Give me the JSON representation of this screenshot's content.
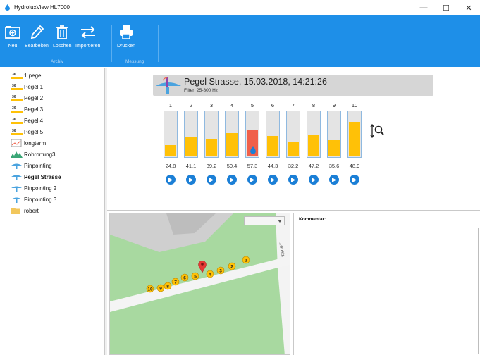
{
  "window": {
    "title": "HydroluxView HL7000",
    "minimize": "—",
    "maximize": "☐",
    "close": "✕"
  },
  "ribbon": {
    "buttons": [
      {
        "label": "Neu",
        "icon": "folder-new-icon"
      },
      {
        "label": "Bearbeiten",
        "icon": "pencil-icon"
      },
      {
        "label": "Löschen",
        "icon": "trash-icon"
      },
      {
        "label": "Importieren",
        "icon": "import-arrows-icon"
      },
      {
        "label": "Drucken",
        "icon": "printer-icon"
      }
    ],
    "groups": [
      "Archiv",
      "Messung"
    ]
  },
  "tree": {
    "items": [
      {
        "label": "1 pegel",
        "icon": "pegel-icon"
      },
      {
        "label": "Pegel 1",
        "icon": "pegel-icon"
      },
      {
        "label": "Pegel 2",
        "icon": "pegel-icon"
      },
      {
        "label": "Pegel 3",
        "icon": "pegel-icon"
      },
      {
        "label": "Pegel 4",
        "icon": "pegel-icon"
      },
      {
        "label": "Pegel 5",
        "icon": "pegel-icon"
      },
      {
        "label": "longterm",
        "icon": "longterm-icon"
      },
      {
        "label": "Rohrortung3",
        "icon": "pipe-locating-icon"
      },
      {
        "label": "Pinpointing",
        "icon": "pinpointing-icon"
      },
      {
        "label": "Pegel Strasse",
        "icon": "pinpointing-icon",
        "selected": true
      },
      {
        "label": "Pinpointing 2",
        "icon": "pinpointing-icon"
      },
      {
        "label": "Pinpointing 3",
        "icon": "pinpointing-icon"
      },
      {
        "label": "robert",
        "icon": "folder-icon"
      }
    ]
  },
  "measurement": {
    "title": "Pegel Strasse, 15.03.2018, 14:21:26",
    "filter": "Filter: 25-800 Hz",
    "channels": [
      {
        "num": "1",
        "value": "24.8",
        "level": 0.248
      },
      {
        "num": "2",
        "value": "41.1",
        "level": 0.411
      },
      {
        "num": "3",
        "value": "39.2",
        "level": 0.392
      },
      {
        "num": "4",
        "value": "50.4",
        "level": 0.504
      },
      {
        "num": "5",
        "value": "57.3",
        "level": 0.573,
        "active": true
      },
      {
        "num": "6",
        "value": "44.3",
        "level": 0.443
      },
      {
        "num": "7",
        "value": "32.2",
        "level": 0.322
      },
      {
        "num": "8",
        "value": "47.2",
        "level": 0.472
      },
      {
        "num": "9",
        "value": "35.6",
        "level": 0.356
      },
      {
        "num": "10",
        "value": "48.9",
        "level": 0.749
      }
    ]
  },
  "map": {
    "markers": [
      "1",
      "2",
      "3",
      "4",
      "5",
      "6",
      "7",
      "8",
      "9",
      "10"
    ],
    "street_label": "...enstr."
  },
  "comment": {
    "label": "Kommentar:",
    "value": ""
  },
  "colors": {
    "ribbon": "#1e8fe8",
    "bar": "#ffc107",
    "bar_active": "#f0604a",
    "play": "#1b7fd6",
    "map_green": "#a8d9a0"
  }
}
